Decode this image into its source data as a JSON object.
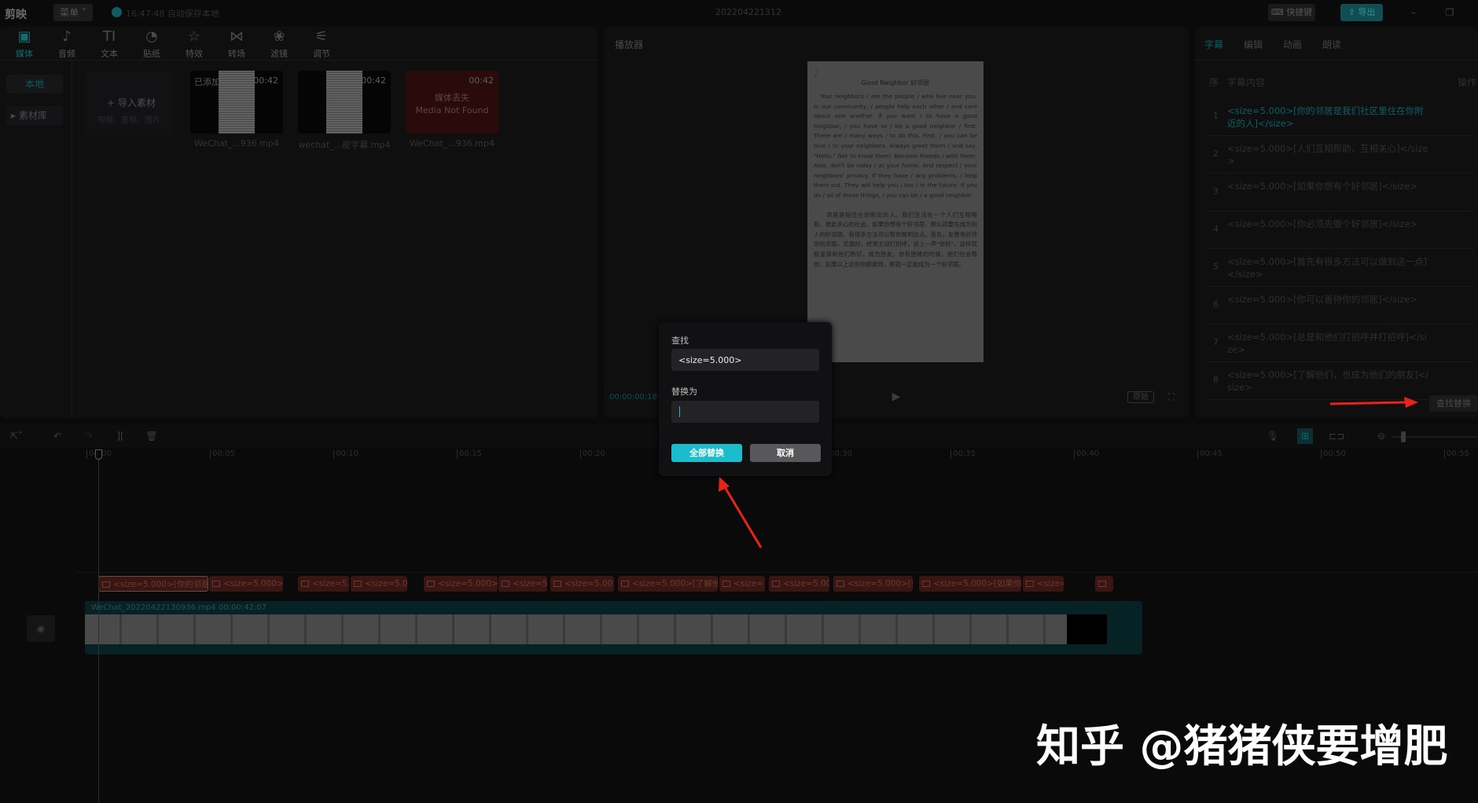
{
  "titlebar": {
    "logo": "剪映",
    "menu": "菜单",
    "save_status": "16:47:48 自动保存本地",
    "project_title": "202204221312",
    "shortcut_btn": "快捷键",
    "export_btn": "导出"
  },
  "toolbar": {
    "items": [
      {
        "label": "媒体",
        "icon": "media-icon",
        "glyph": "▣"
      },
      {
        "label": "音频",
        "icon": "audio-icon",
        "glyph": "♪"
      },
      {
        "label": "文本",
        "icon": "text-icon",
        "glyph": "TI"
      },
      {
        "label": "贴纸",
        "icon": "sticker-icon",
        "glyph": "◔"
      },
      {
        "label": "特效",
        "icon": "effects-icon",
        "glyph": "☆"
      },
      {
        "label": "转场",
        "icon": "transition-icon",
        "glyph": "⋈"
      },
      {
        "label": "滤镜",
        "icon": "filter-icon",
        "glyph": "❀"
      },
      {
        "label": "调节",
        "icon": "adjust-icon",
        "glyph": "⚟"
      }
    ]
  },
  "media_sidebar": {
    "local": "本地",
    "library": "素材库"
  },
  "import": {
    "label": "导入素材",
    "hint": "视频、音频、图片"
  },
  "media": [
    {
      "badge": "已添加",
      "duration": "00:42",
      "name": "WeChat_...936.mp4"
    },
    {
      "badge": "",
      "duration": "00:42",
      "name": "wechat_...能字幕.mp4"
    },
    {
      "missing_cn": "媒体丢失",
      "missing_en": "Media Not Found",
      "duration": "00:42",
      "name": "WeChat_...936.mp4"
    }
  ],
  "player": {
    "title": "播放器",
    "timecode": "00:00:00:18",
    "original_btn": "原始",
    "preview_title": "Good Neighbor 好邻居",
    "preview_en": "Your neighbors / are the people / who live near you. In our community, / people help each other / and care about one another. If you want / to have a good neighbor, / you have to / be a good neighbor / first. There are / many ways / to do this. First, / you can be nice / to your neighbors. Always greet them / and say, \"Hello.\" Get to know them. Become friends / with them. Also, don't be noisy / at your home. And respect / your neighbors' privacy. If they have / any problems, / help them out. They will help you / too / in the future. If you do / all of these things, / you can be / a good neighbor.",
    "preview_cn": "邻居是指住在你附近的人。我们生活在一个人们互相帮助、彼此关心的社会。如果你想有个好邻居，那么就要先成为别人的好邻居。有很多方法可以帮你做到这点。首先，友善地对待你的邻居。见面时，经常主动打招呼，说上一声\"你好\"。这样就能逐渐和他们熟识，成为朋友。你有困难的时候，他们也会帮你。如果以上这些你都做到，那就一定能成为一个好邻居。"
  },
  "right_panel": {
    "tabs": [
      "字幕",
      "编辑",
      "动画",
      "朗读"
    ],
    "col_index": "序",
    "col_content": "字幕内容",
    "col_action": "操作",
    "find_replace_btn": "查找替换",
    "rows": [
      {
        "n": "1",
        "text": "<size=5.000>[你的邻居是我们社区里住在你附近的人]</size>"
      },
      {
        "n": "2",
        "text": "<size=5.000>[人们互相帮助，互相关心]</size>"
      },
      {
        "n": "3",
        "text": "<size=5.000>[如果你想有个好邻居]</size>"
      },
      {
        "n": "4",
        "text": "<size=5.000>[你必须先做个好邻居]</size>"
      },
      {
        "n": "5",
        "text": "<size=5.000>[首先有很多方法可以做到这一点]</size>"
      },
      {
        "n": "6",
        "text": "<size=5.000>[你可以善待你的邻居]</size>"
      },
      {
        "n": "7",
        "text": "<size=5.000>[总是和他们打招呼并打招呼]</size>"
      },
      {
        "n": "8",
        "text": "<size=5.000>[了解他们，也成为他们的朋友]</size>"
      }
    ]
  },
  "timeline": {
    "ruler": [
      "00:00",
      "00:05",
      "00:10",
      "00:15",
      "00:20",
      "00:25",
      "00:30",
      "00:35",
      "00:40",
      "00:45",
      "00:50",
      "00:55"
    ],
    "subtitle_clips": [
      "<size=5.000>[你的邻居是",
      "<size=5.000>[人",
      "<size=5.",
      "<size=5.00",
      "<size=5.000>[",
      "<size=5.",
      "<size=5.00",
      "<size=5.000>[了解他",
      "<size=",
      "<size=5.00",
      "<size=5.000>[如",
      "<size=5.000>[如果你想",
      "<size=",
      ""
    ],
    "video_name": "WeChat_20220422130936.mp4",
    "video_duration": "00:00:42:07"
  },
  "dialog": {
    "find_label": "查找",
    "find_value": "<size=5.000>",
    "replace_label": "替换为",
    "replace_value": "",
    "replace_all_btn": "全部替换",
    "cancel_btn": "取消"
  },
  "watermark": "知乎 @猪猪侠要增肥",
  "colors": {
    "accent": "#1bbccb",
    "annotation_arrow": "#e8231c",
    "background": "#0a0a0b"
  }
}
